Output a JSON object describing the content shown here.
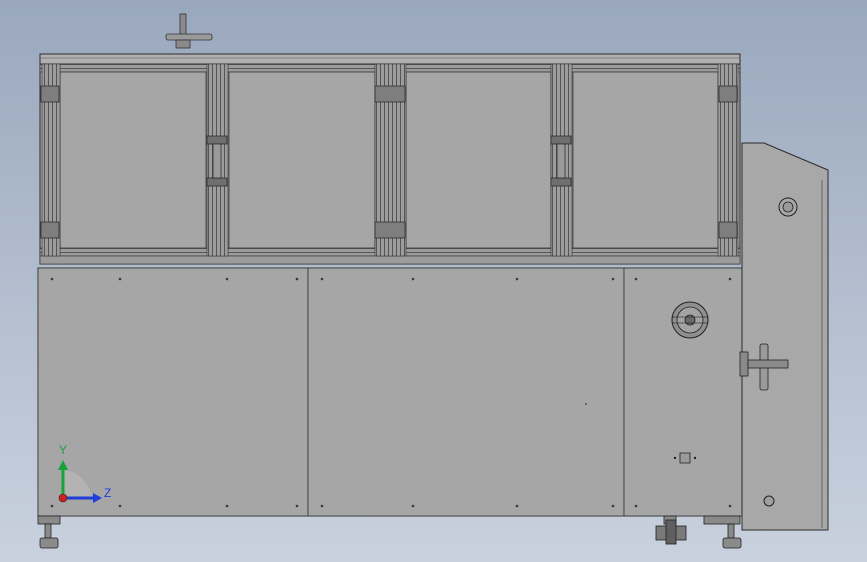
{
  "viewport": {
    "background_top": "#9aa8be",
    "background_bottom": "#c9d1de"
  },
  "model": {
    "panel_color": "#a6a6a6",
    "frame_color": "#8c8c8c",
    "outline_color": "#2b2b2b"
  },
  "triad": {
    "y_label": "Y",
    "z_label": "Z",
    "y_color": "#17a33a",
    "z_color": "#1f3fd8",
    "origin_color": "#d02020"
  }
}
